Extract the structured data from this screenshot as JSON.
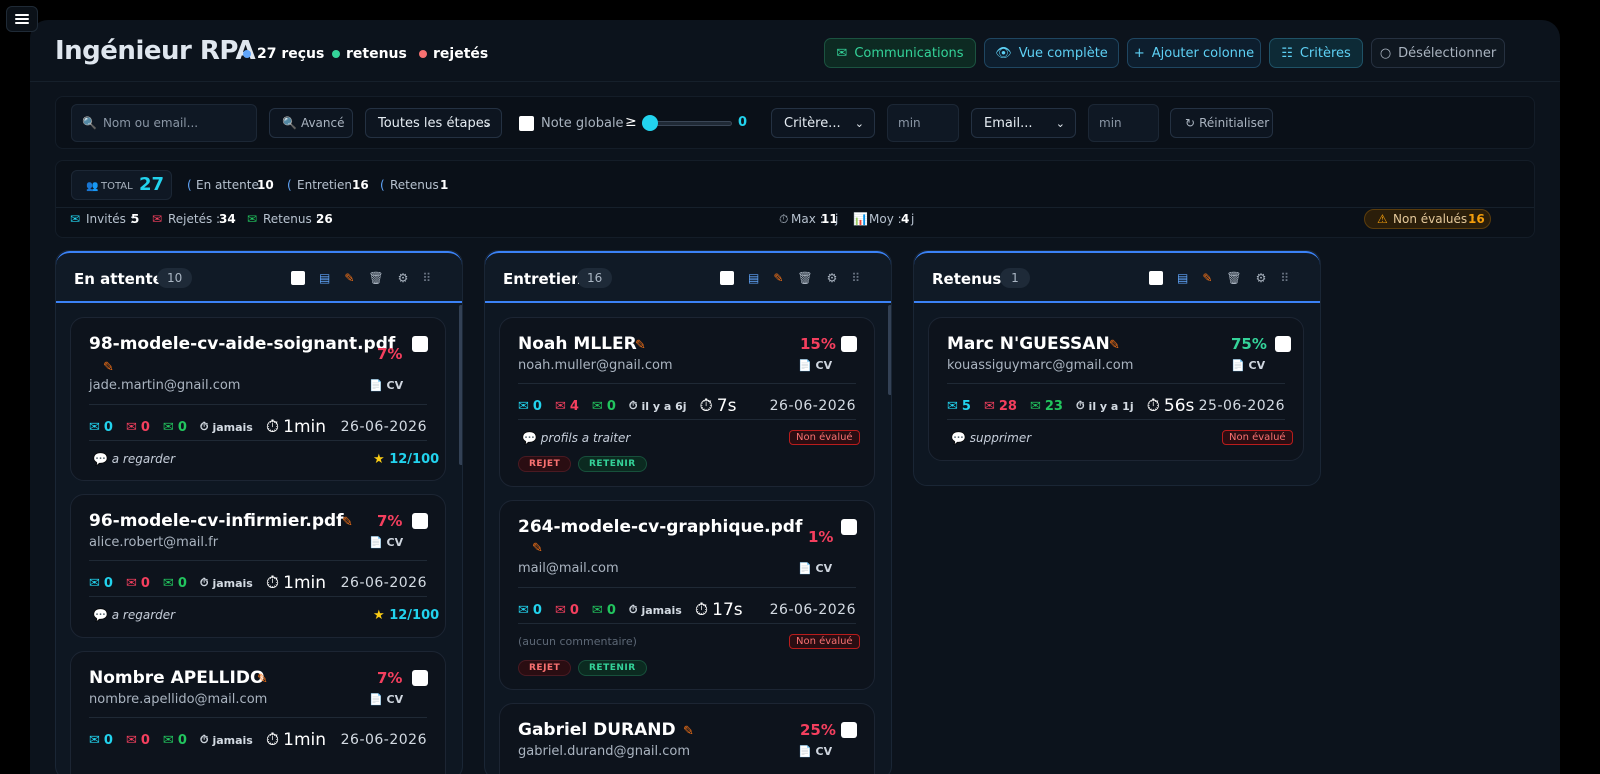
{
  "header": {
    "title": "Ingénieur RPA",
    "stats": [
      {
        "label": "27 reçus",
        "color": "#60a5fa"
      },
      {
        "label": "retenus",
        "color": "#34d399"
      },
      {
        "label": "rejetés",
        "color": "#f87171"
      }
    ],
    "buttons": {
      "communications": "Communications",
      "vue": "Vue complète",
      "ajouter": "Ajouter colonne",
      "criteres": "Critères",
      "deselect": "Désélectionner"
    }
  },
  "filters": {
    "search_placeholder": "Nom ou email...",
    "avance": "Avancé",
    "etapes": "Toutes les étapes",
    "note_label": "Note globale",
    "ge": "≥",
    "slider_value": "0",
    "critere": "Critère...",
    "min1": "min",
    "email": "Email...",
    "min2": "min",
    "reset": "Réinitialiser"
  },
  "summary": {
    "total_label": "TOTAL",
    "total": "27",
    "en_attente_label": "En attente",
    "en_attente": "10",
    "entretien_label": "Entretien",
    "entretien": "16",
    "retenus_label": "Retenus",
    "retenus": "1",
    "invites_label": "Invités :",
    "invites": "5",
    "rejetes_label": "Rejetés :",
    "rejetes": "34",
    "retenus2_label": "Retenus :",
    "retenus2": "26",
    "max_label": "Max :",
    "max": "11",
    "moy_label": "Moy :",
    "moy": "4",
    "unit": "j",
    "nonevalues_label": "Non évalués :",
    "nonevalues": "16"
  },
  "columns": [
    {
      "title": "En attente",
      "count": "10",
      "cards": [
        {
          "name": "98-modele-cv-aide-soignant.pdf",
          "pct": "7%",
          "email": "jade.martin@gnail.com",
          "cv": "CV",
          "mail": "0",
          "rej": "0",
          "ret": "0",
          "last": "jamais",
          "time": "1min",
          "date": "26-06-2026",
          "comment": "a regarder",
          "score": "12/100"
        },
        {
          "name": "96-modele-cv-infirmier.pdf",
          "pct": "7%",
          "email": "alice.robert@mail.fr",
          "cv": "CV",
          "mail": "0",
          "rej": "0",
          "ret": "0",
          "last": "jamais",
          "time": "1min",
          "date": "26-06-2026",
          "comment": "a regarder",
          "score": "12/100"
        },
        {
          "name": "Nombre APELLIDO",
          "pct": "7%",
          "email": "nombre.apellido@mail.com",
          "cv": "CV",
          "mail": "0",
          "rej": "0",
          "ret": "0",
          "last": "jamais",
          "time": "1min",
          "date": "26-06-2026"
        }
      ]
    },
    {
      "title": "Entretien",
      "count": "16",
      "cards": [
        {
          "name": "Noah MLLER",
          "pct": "15%",
          "email": "noah.muller@gnail.com",
          "cv": "CV",
          "mail": "0",
          "rej": "4",
          "ret": "0",
          "last": "il y a 6j",
          "time": "7s",
          "date": "26-06-2026",
          "comment": "profils a traiter",
          "badge": "Non évalué",
          "reject": "REJET",
          "retain": "RETENIR"
        },
        {
          "name": "264-modele-cv-graphique.pdf",
          "pct": "1%",
          "email": "mail@mail.com",
          "cv": "CV",
          "mail": "0",
          "rej": "0",
          "ret": "0",
          "last": "jamais",
          "time": "17s",
          "date": "26-06-2026",
          "comment": "(aucun commentaire)",
          "badge": "Non évalué",
          "reject": "REJET",
          "retain": "RETENIR"
        },
        {
          "name": "Gabriel DURAND",
          "pct": "25%",
          "email": "gabriel.durand@gnail.com",
          "cv": "CV"
        }
      ]
    },
    {
      "title": "Retenus",
      "count": "1",
      "cards": [
        {
          "name": "Marc N'GUESSAN",
          "pct": "75%",
          "email": "kouassiguymarc@gmail.com",
          "cv": "CV",
          "mail": "5",
          "rej": "28",
          "ret": "23",
          "last": "il y a 1j",
          "time": "56s",
          "date": "25-06-2026",
          "comment": "supprimer",
          "badge": "Non évalué"
        }
      ]
    }
  ]
}
